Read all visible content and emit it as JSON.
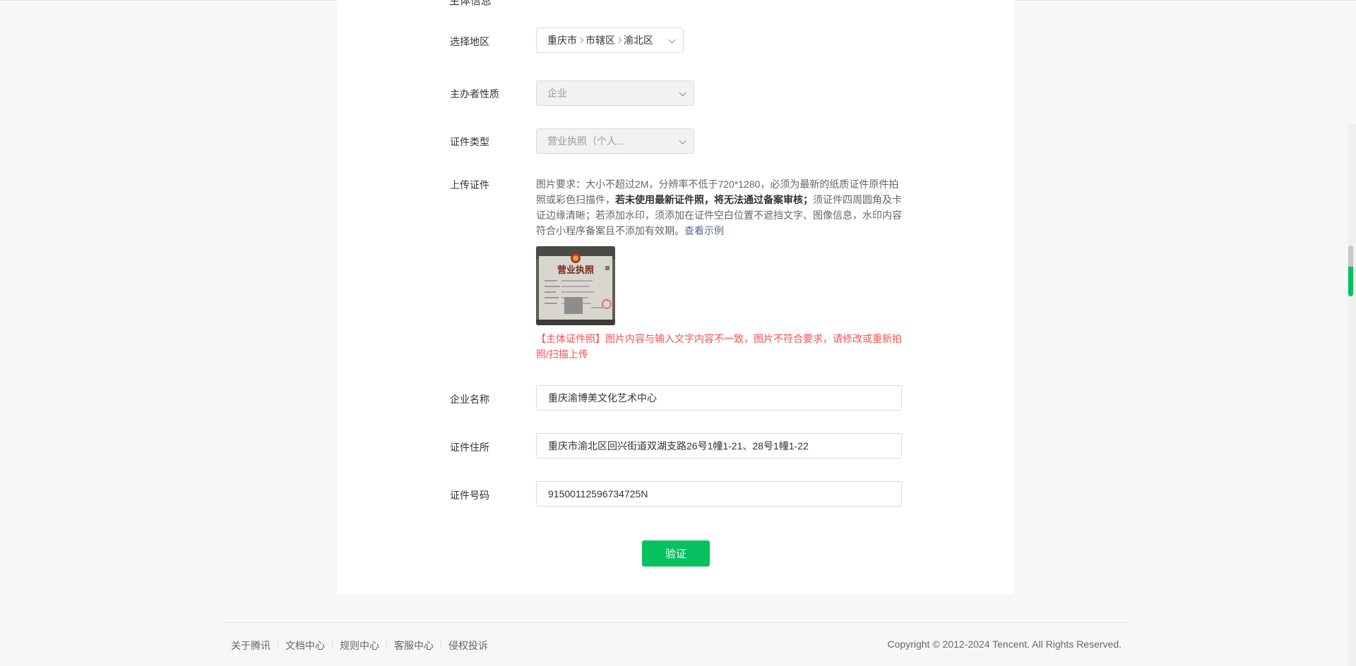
{
  "form": {
    "clipped_section_title": "主体信息",
    "region": {
      "label": "选择地区",
      "levels": [
        "重庆市",
        "市辖区",
        "渝北区"
      ],
      "icon": "chevron-down-icon"
    },
    "organizer_type": {
      "label": "主办者性质",
      "value": "企业"
    },
    "certificate_type": {
      "label": "证件类型",
      "value": "营业执照（个人..."
    },
    "upload": {
      "label": "上传证件",
      "desc_part1": "图片要求：大小不超过2M，分辨率不低于720*1280，必须为最新的纸质证件原件拍照或彩色扫描件，",
      "desc_bold": "若未使用最新证件照，将无法通过备案审核；",
      "desc_part2": "须证件四周圆角及卡证边缘清晰；若添加水印，须添加在证件空白位置不遮挡文字、图像信息，水印内容符合小程序备案且不添加有效期。",
      "example_link": "查看示例",
      "thumbnail_text": "营业执照",
      "error_message": "【主体证件照】图片内容与输入文字内容不一致，图片不符合要求，请修改或重新拍照/扫描上传"
    },
    "company_name": {
      "label": "企业名称",
      "value": "重庆渝博美文化艺术中心"
    },
    "cert_address": {
      "label": "证件住所",
      "value": "重庆市渝北区回兴街道双湖支路26号1幢1-21、28号1幢1-22"
    },
    "cert_number": {
      "label": "证件号码",
      "value": "91500112596734725N"
    },
    "verify_button": "验证"
  },
  "footer": {
    "links": [
      "关于腾讯",
      "文档中心",
      "规则中心",
      "客服中心",
      "侵权投诉"
    ],
    "copyright": "Copyright © 2012-2024 Tencent. All Rights Reserved."
  },
  "colors": {
    "primary": "#07c160",
    "error": "#fa5151",
    "link": "#576b95"
  }
}
